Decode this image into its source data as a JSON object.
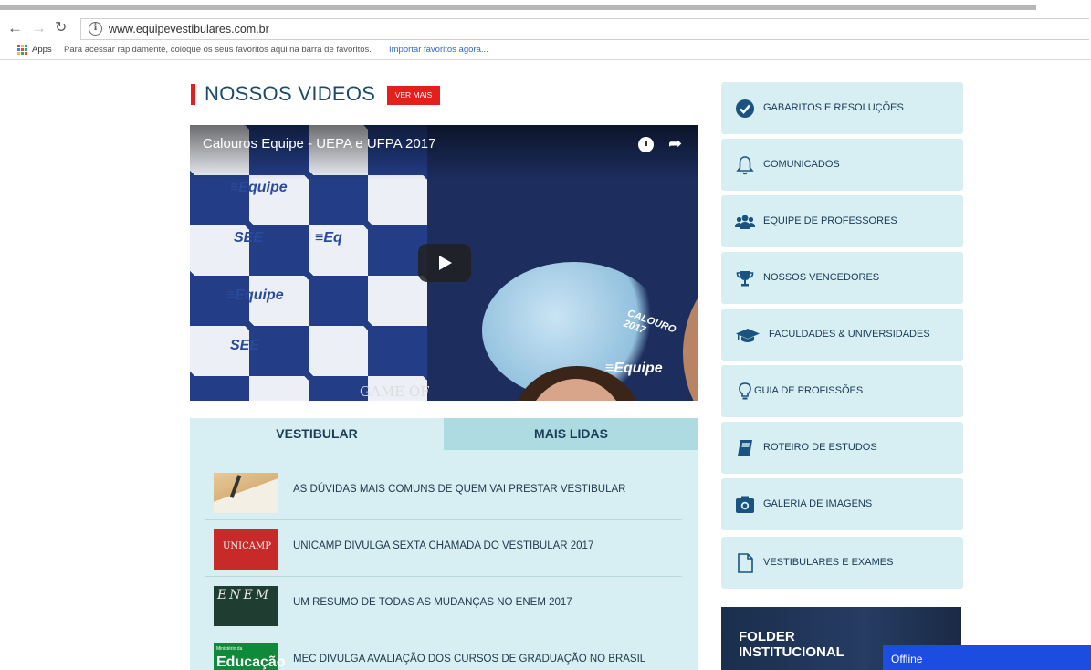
{
  "browser": {
    "url": "www.equipevestibulares.com.br",
    "bookmarks_apps_label": "Apps",
    "bookmarks_hint": "Para acessar rapidamente, coloque os seus favoritos aqui na barra de favoritos.",
    "bookmarks_import": "Importar favoritos agora..."
  },
  "videos": {
    "section_title": "NOSSOS VIDEOS",
    "more_button": "VER MAIS",
    "video_title": "Calouros Equipe - UEPA e UFPA 2017"
  },
  "video_frame_text": {
    "logo_1": "≡Equipe",
    "logo_2": "≡Equipe",
    "logo_see_1": "SEE",
    "logo_see_2": "SEE",
    "logo_eq": "≡Eq",
    "shirt_logo": "≡Equipe",
    "calouro": "CALOURO 2017",
    "game": "GAME OF"
  },
  "tabs": {
    "active": "VESTIBULAR",
    "inactive": "MAIS LIDAS"
  },
  "news": [
    {
      "title": "AS DÚVIDAS MAIS COMUNS DE QUEM VAI PRESTAR VESTIBULAR"
    },
    {
      "title": "UNICAMP DIVULGA SEXTA CHAMADA DO VESTIBULAR 2017",
      "thumb_text": "UNICAMP"
    },
    {
      "title": "UM RESUMO DE TODAS AS MUDANÇAS NO ENEM 2017",
      "thumb_text": "ENEM"
    },
    {
      "title": "MEC DIVULGA AVALIAÇÃO DOS CURSOS DE GRADUAÇÃO NO BRASIL",
      "thumb_text_small": "Ministério da",
      "thumb_text": "Educação"
    }
  ],
  "sidebar": {
    "items": [
      {
        "label": "GABARITOS E RESOLUÇÕES",
        "icon": "check-circle-icon"
      },
      {
        "label": "COMUNICADOS",
        "icon": "bell-icon"
      },
      {
        "label": "EQUIPE DE PROFESSORES",
        "icon": "users-icon"
      },
      {
        "label": "NOSSOS VENCEDORES",
        "icon": "trophy-icon"
      },
      {
        "label": "FACULDADES & UNIVERSIDADES",
        "icon": "graduation-cap-icon"
      },
      {
        "label": "GUIA DE PROFISSÕES",
        "icon": "lightbulb-icon"
      },
      {
        "label": "ROTEIRO DE ESTUDOS",
        "icon": "book-icon"
      },
      {
        "label": "GALERIA DE IMAGENS",
        "icon": "camera-icon"
      },
      {
        "label": "VESTIBULARES E EXAMES",
        "icon": "file-icon"
      }
    ],
    "folder_line1": "FOLDER",
    "folder_line2": "INSTITUCIONAL"
  },
  "chat": {
    "status": "Offline"
  },
  "colors": {
    "accent_red": "#e3201b",
    "panel": "#d7eef2",
    "navy": "#1b5380",
    "chat_blue": "#1d4de0"
  }
}
